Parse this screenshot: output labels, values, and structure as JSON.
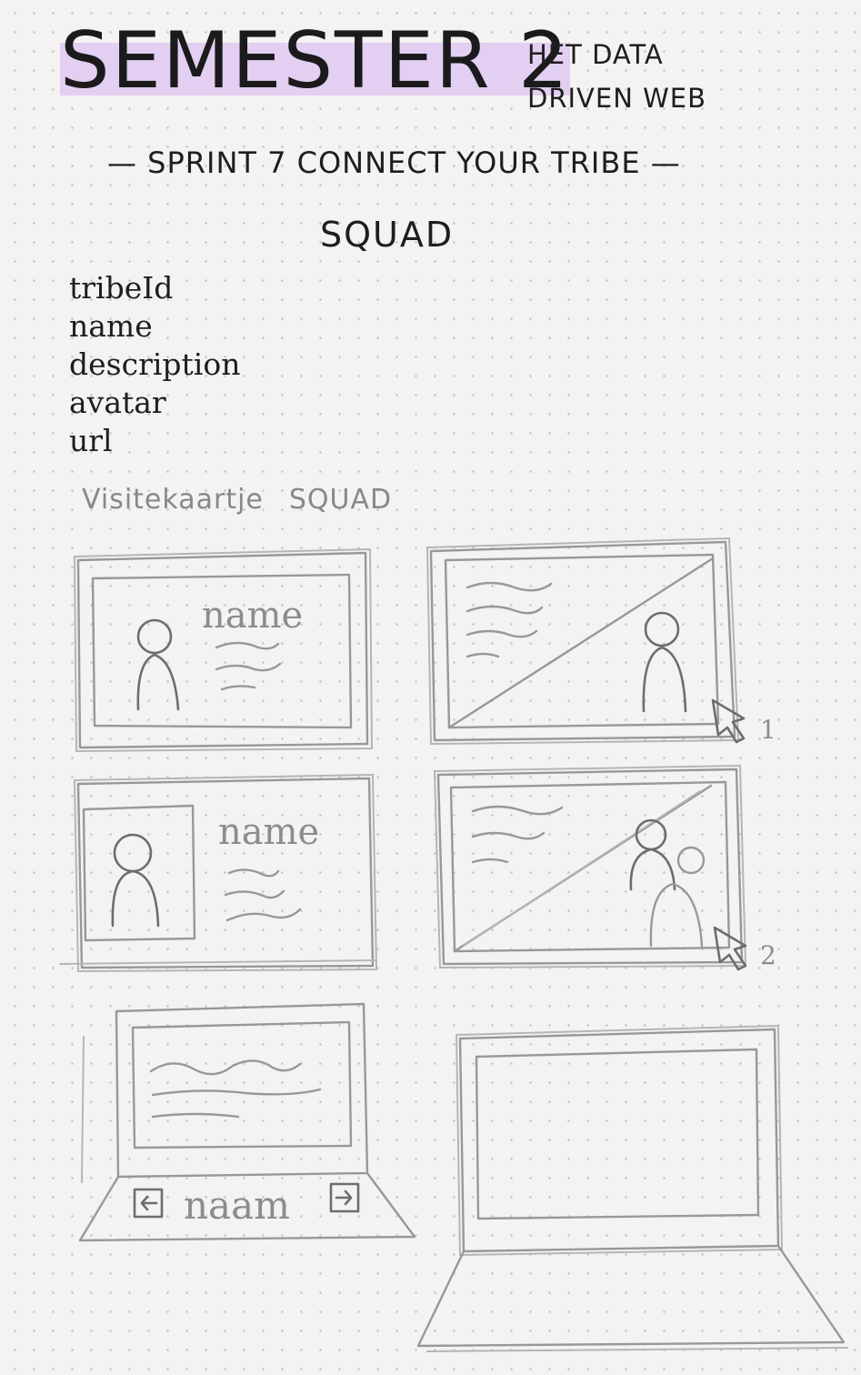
{
  "header": {
    "title": "SEMESTER 2",
    "subtitle_line1": "HET DATA",
    "subtitle_line2": "DRIVEN WEB"
  },
  "sprint": {
    "label": "— SPRINT 7 CONNECT YOUR TRIBE —"
  },
  "squad": {
    "title": "SQUAD",
    "fields": [
      "tribeId",
      "name",
      "description",
      "avatar",
      "url"
    ]
  },
  "card_section": {
    "title_word1": "Visitekaartje",
    "title_word2": "SQUAD"
  },
  "sketches": {
    "card1_name": "name",
    "card3_name": "name",
    "laptop_name": "naam",
    "cursor1_number": "1",
    "cursor2_number": "2",
    "cursor_icon": "arrow-cursor-icon",
    "laptop_prev_icon": "arrow-left-icon",
    "laptop_next_icon": "arrow-right-icon"
  }
}
